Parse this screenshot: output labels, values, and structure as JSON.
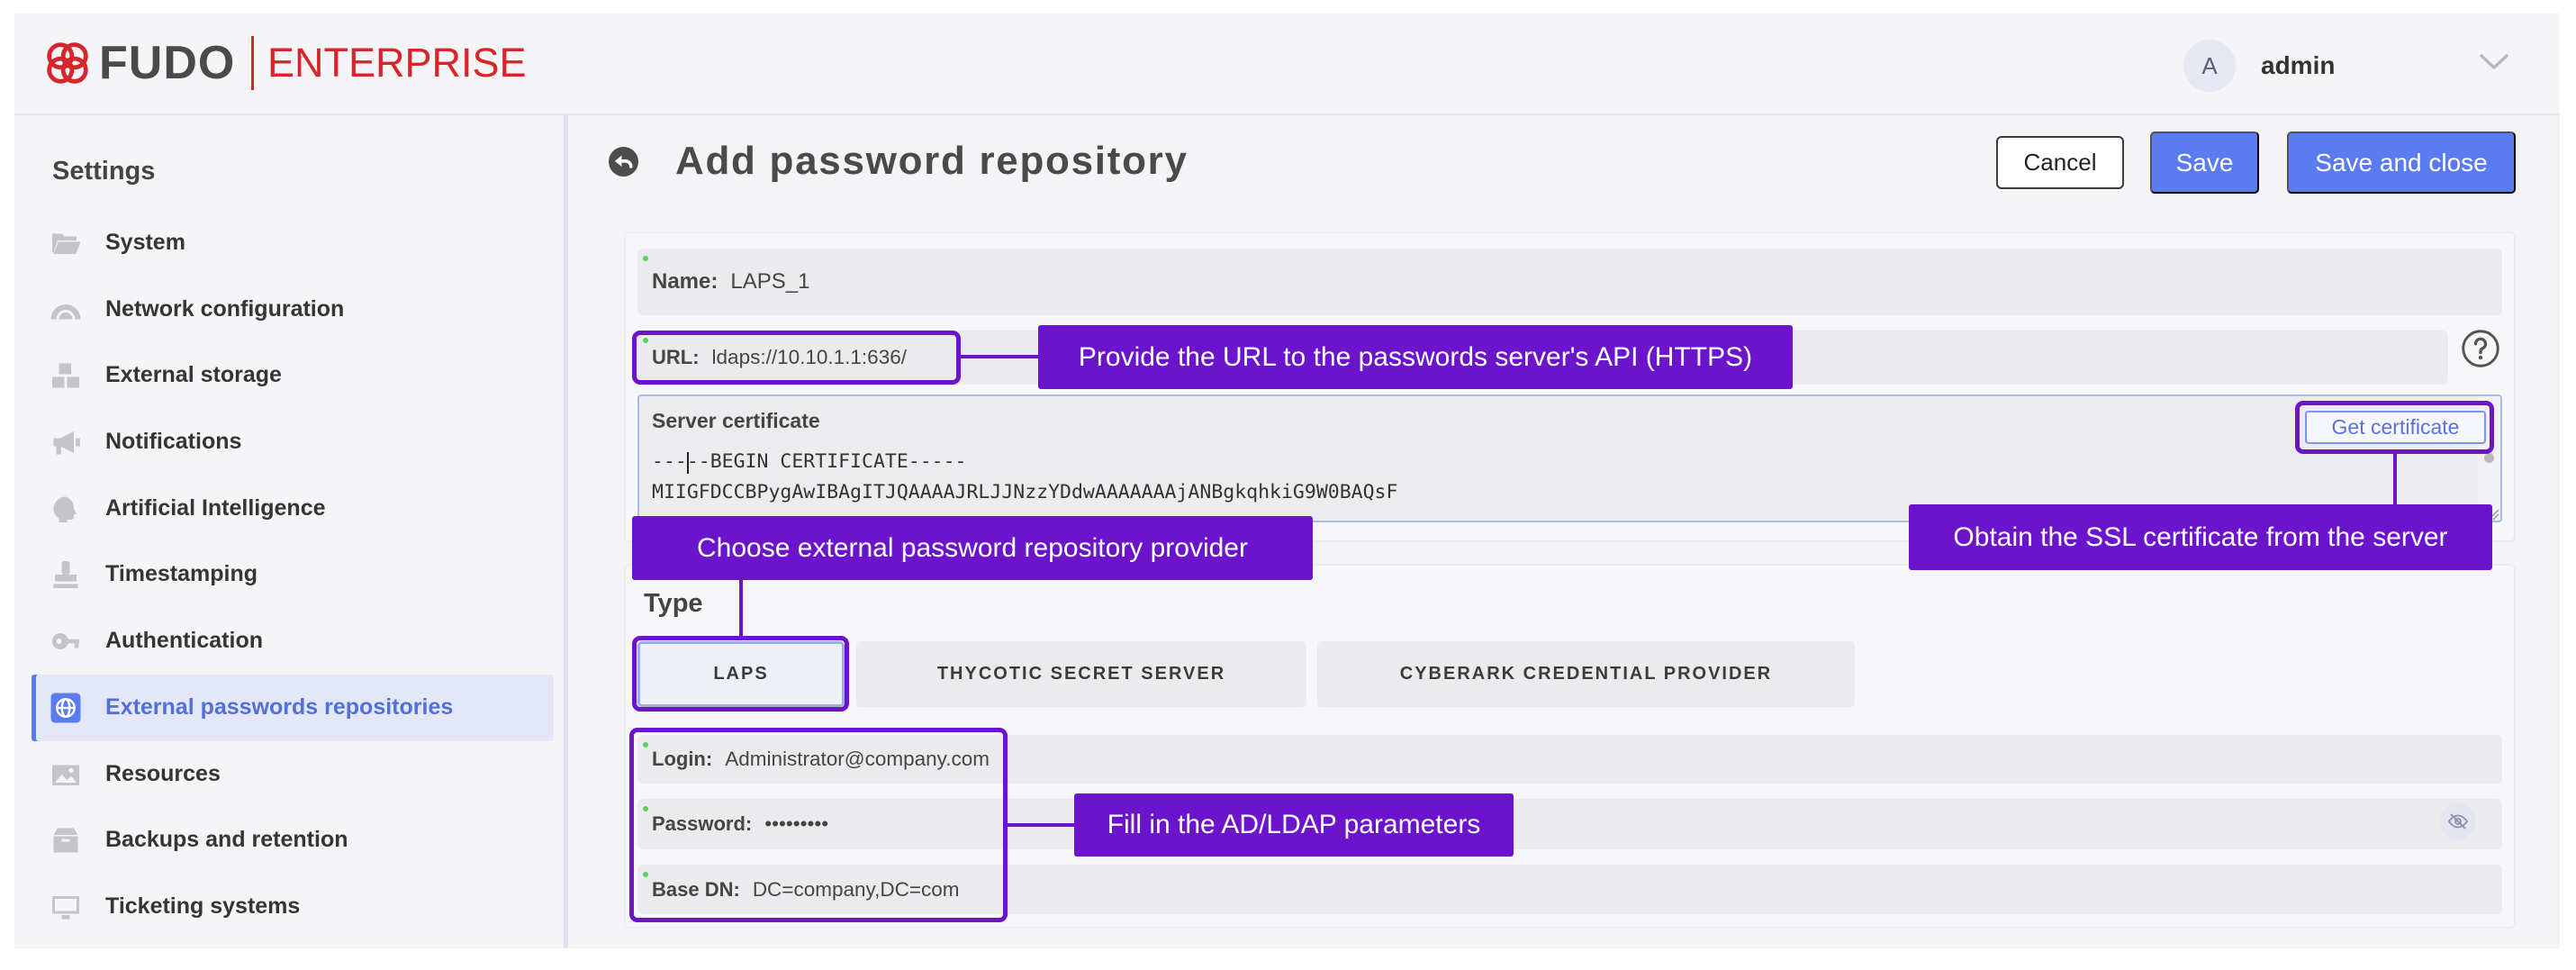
{
  "theme": {
    "brand_color": "#d7262b",
    "accent_color": "#5b7cf0",
    "annotation_color": "#6b14cc"
  },
  "header": {
    "logo_icon": "fudo-logo-icon",
    "brand": "FUDO",
    "product": "ENTERPRISE",
    "avatar_initial": "A",
    "username": "admin",
    "menu_icon": "chevron-down-icon"
  },
  "sidebar": {
    "title": "Settings",
    "items": [
      {
        "label": "System",
        "icon": "folder-icon"
      },
      {
        "label": "Network configuration",
        "icon": "network-icon"
      },
      {
        "label": "External storage",
        "icon": "storage-icon"
      },
      {
        "label": "Notifications",
        "icon": "megaphone-icon"
      },
      {
        "label": "Artificial Intelligence",
        "icon": "brain-icon"
      },
      {
        "label": "Timestamping",
        "icon": "stamp-icon"
      },
      {
        "label": "Authentication",
        "icon": "key-icon"
      },
      {
        "label": "External passwords repositories",
        "icon": "globe-icon",
        "active": true
      },
      {
        "label": "Resources",
        "icon": "image-icon"
      },
      {
        "label": "Backups and retention",
        "icon": "archive-icon"
      },
      {
        "label": "Ticketing systems",
        "icon": "monitor-icon"
      }
    ]
  },
  "page": {
    "back_icon": "back-arrow-icon",
    "title": "Add password repository",
    "cancel_label": "Cancel",
    "save_label": "Save",
    "save_close_label": "Save and close"
  },
  "form": {
    "name": {
      "label": "Name:",
      "value": "LAPS_1"
    },
    "url": {
      "label": "URL:",
      "value": "ldaps://10.10.1.1:636/",
      "help_icon": "help-icon"
    },
    "certificate": {
      "label": "Server certificate",
      "lines": [
        "-----BEGIN CERTIFICATE-----",
        "MIIGFDCCBPygAwIBAgITJQAAAAJRLJJNzzYDdwAAAAAAAjANBgkqhkiG9W0BAQsF"
      ],
      "get_button_label": "Get certificate"
    },
    "type": {
      "label": "Type",
      "options": [
        "LAPS",
        "THYCOTIC SECRET SERVER",
        "CYBERARK CREDENTIAL PROVIDER"
      ],
      "selected": "LAPS"
    },
    "login": {
      "label": "Login:",
      "value": "Administrator@company.com"
    },
    "password": {
      "label": "Password:",
      "value": "•••••••••",
      "toggle_icon": "eye-off-icon"
    },
    "base_dn": {
      "label": "Base DN:",
      "value": "DC=company,DC=com"
    }
  },
  "annotations": {
    "url": "Provide the URL to the passwords server's API (HTTPS)",
    "certificate": "Obtain the SSL certificate from the server",
    "type": "Choose external password repository provider",
    "ldap": "Fill in the AD/LDAP parameters"
  }
}
